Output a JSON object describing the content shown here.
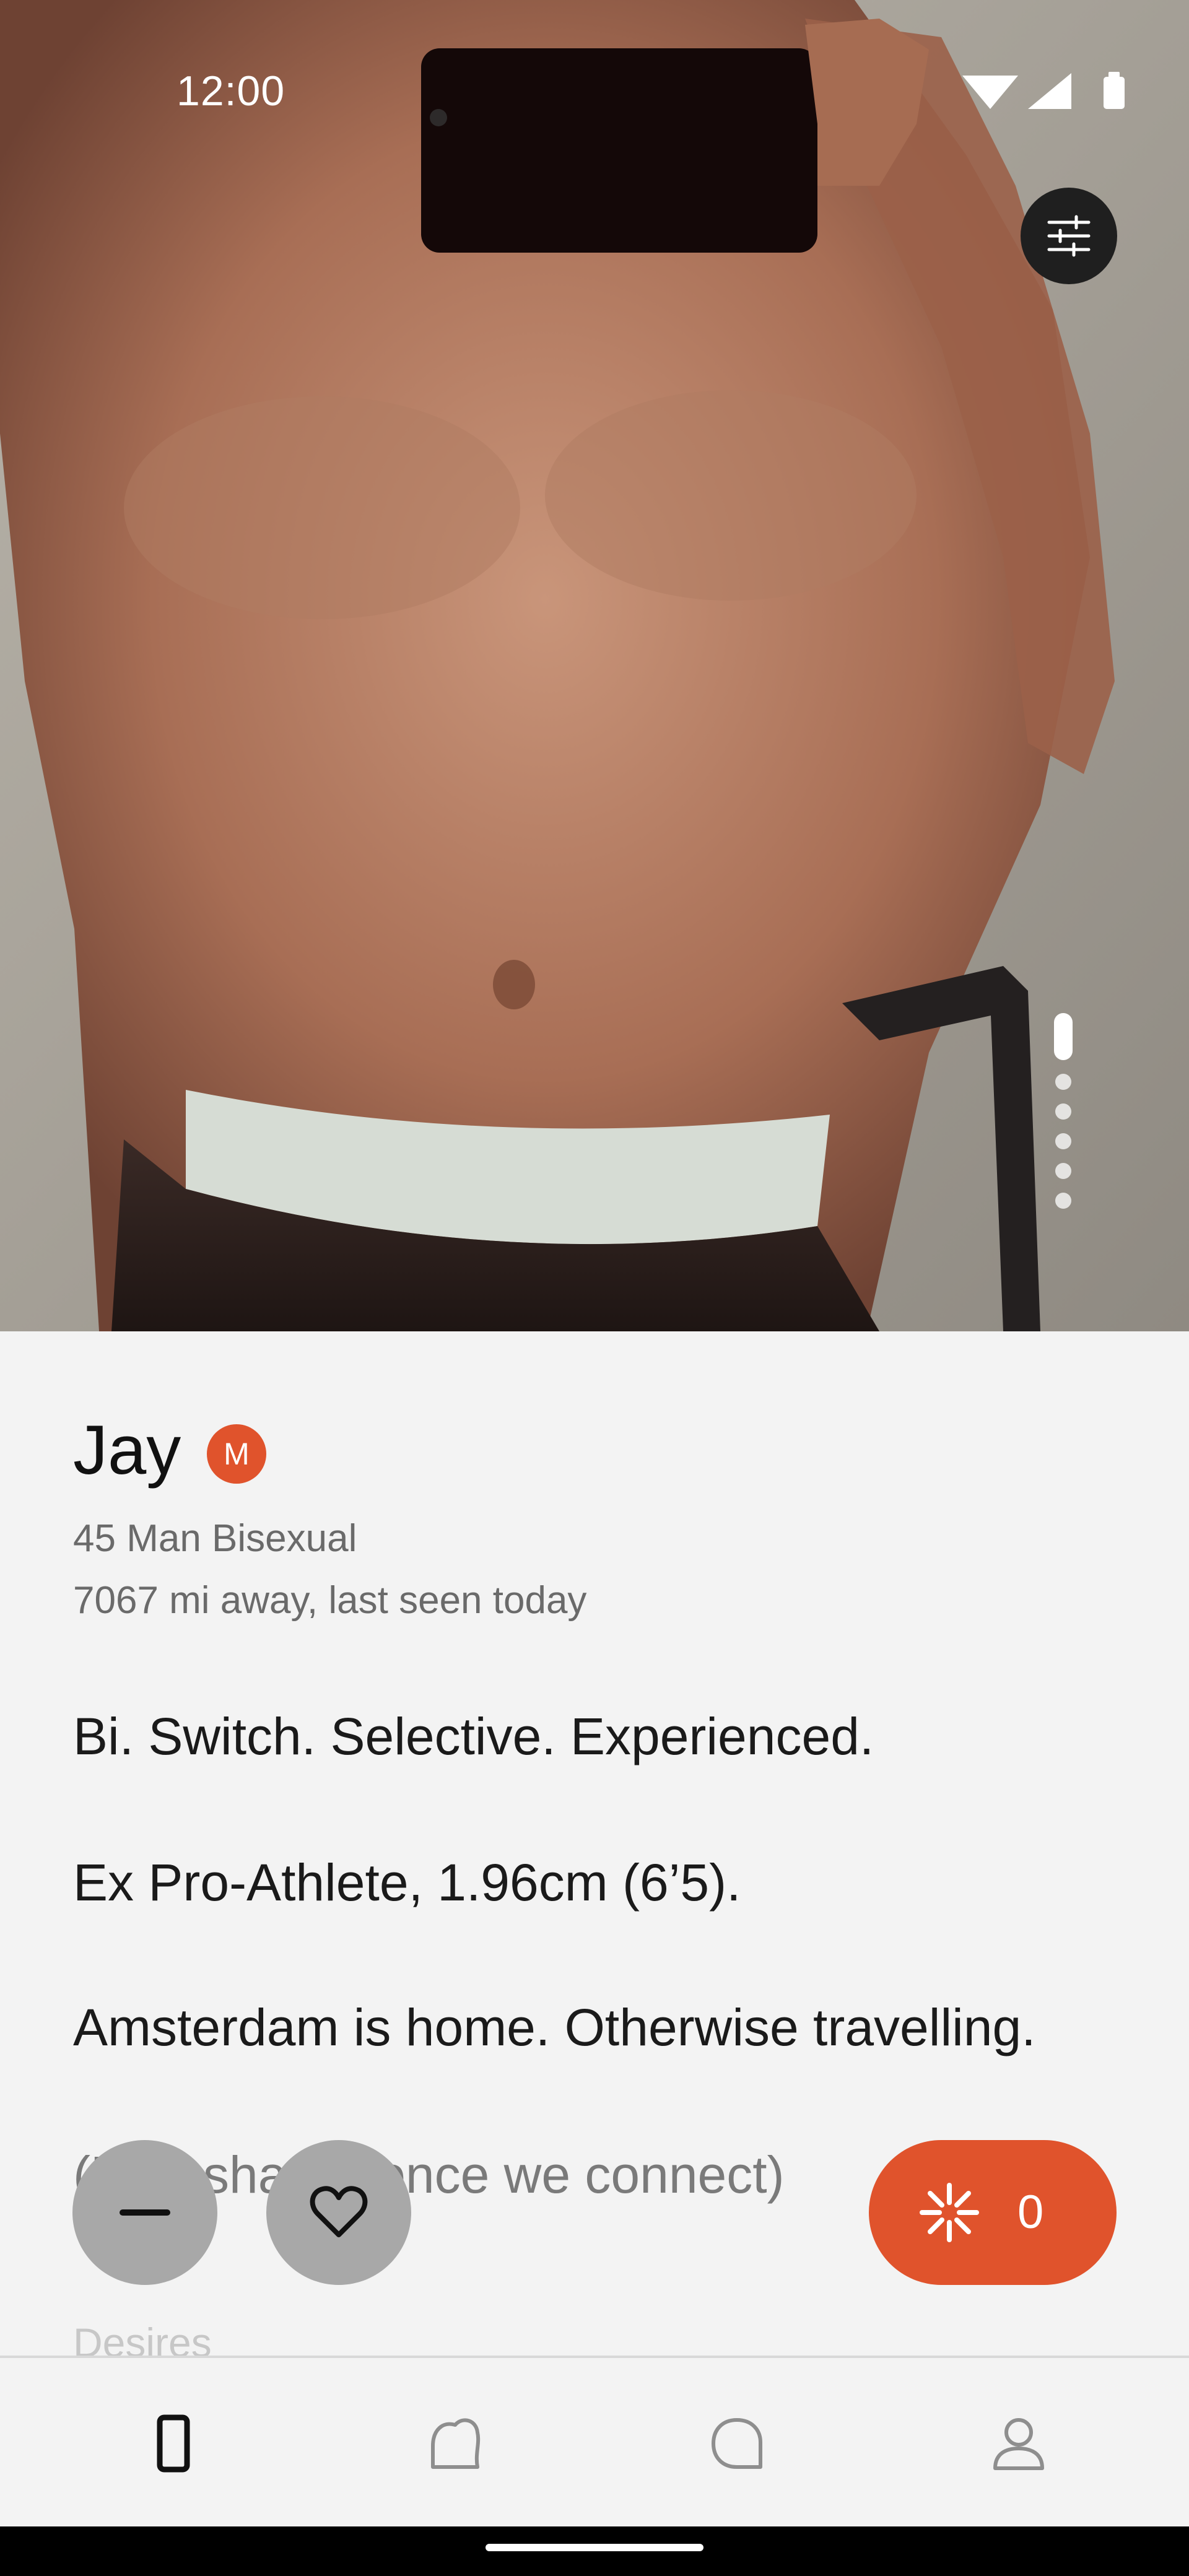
{
  "status_bar": {
    "time": "12:00",
    "icons": [
      "wifi-icon",
      "cellular-signal-icon",
      "battery-icon"
    ]
  },
  "photo": {
    "pager": {
      "total": 6,
      "active_index": 0
    }
  },
  "profile": {
    "name": "Jay",
    "badge": "M",
    "details": "45 Man Bisexual",
    "distance": "7067 mi away, last seen today",
    "bio": [
      "Bi. Switch. Selective. Experienced.",
      "Ex Pro-Athlete, 1.96cm (6’5).",
      "Amsterdam is home. Otherwise travelling.",
      "(Pics shared once we connect)"
    ],
    "next_section": "Desires"
  },
  "actions": {
    "dislike_icon": "minus-icon",
    "like_icon": "heart-icon",
    "spark_icon": "spark-icon",
    "spark_count": "0"
  },
  "nav": {
    "items": [
      {
        "id": "discover",
        "icon": "card-icon",
        "active": true
      },
      {
        "id": "likes",
        "icon": "bubble-blob-icon",
        "active": false
      },
      {
        "id": "chats",
        "icon": "chat-bubble-icon",
        "active": false
      },
      {
        "id": "profile",
        "icon": "person-icon",
        "active": false
      }
    ]
  },
  "colors": {
    "accent": "#e0532c",
    "background": "#f3f3f3",
    "action_gray": "#a8a8a8"
  }
}
